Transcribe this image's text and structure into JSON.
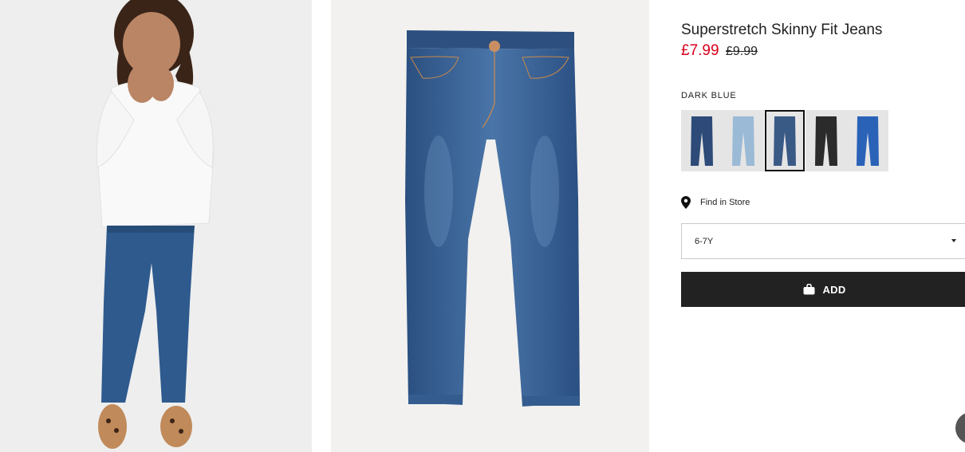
{
  "product": {
    "title": "Superstretch Skinny Fit Jeans",
    "price_sale": "£7.99",
    "price_original": "£9.99",
    "sale_color": "#d6001c"
  },
  "colors": {
    "selected_label": "DARK BLUE",
    "swatches": [
      {
        "name": "Denim blue",
        "tone": "#2d4a78"
      },
      {
        "name": "Light denim blue",
        "tone": "#9bbad6"
      },
      {
        "name": "Dark blue",
        "tone": "#3a5a86"
      },
      {
        "name": "Black",
        "tone": "#2b2b2b"
      },
      {
        "name": "Bright blue",
        "tone": "#2a62b8"
      }
    ]
  },
  "store": {
    "label": "Find in Store",
    "icon": "location-pin-icon"
  },
  "size_select": {
    "value": "6-7Y"
  },
  "add_button": {
    "label": "ADD",
    "icon": "shopping-bag-icon",
    "background": "#222222"
  }
}
